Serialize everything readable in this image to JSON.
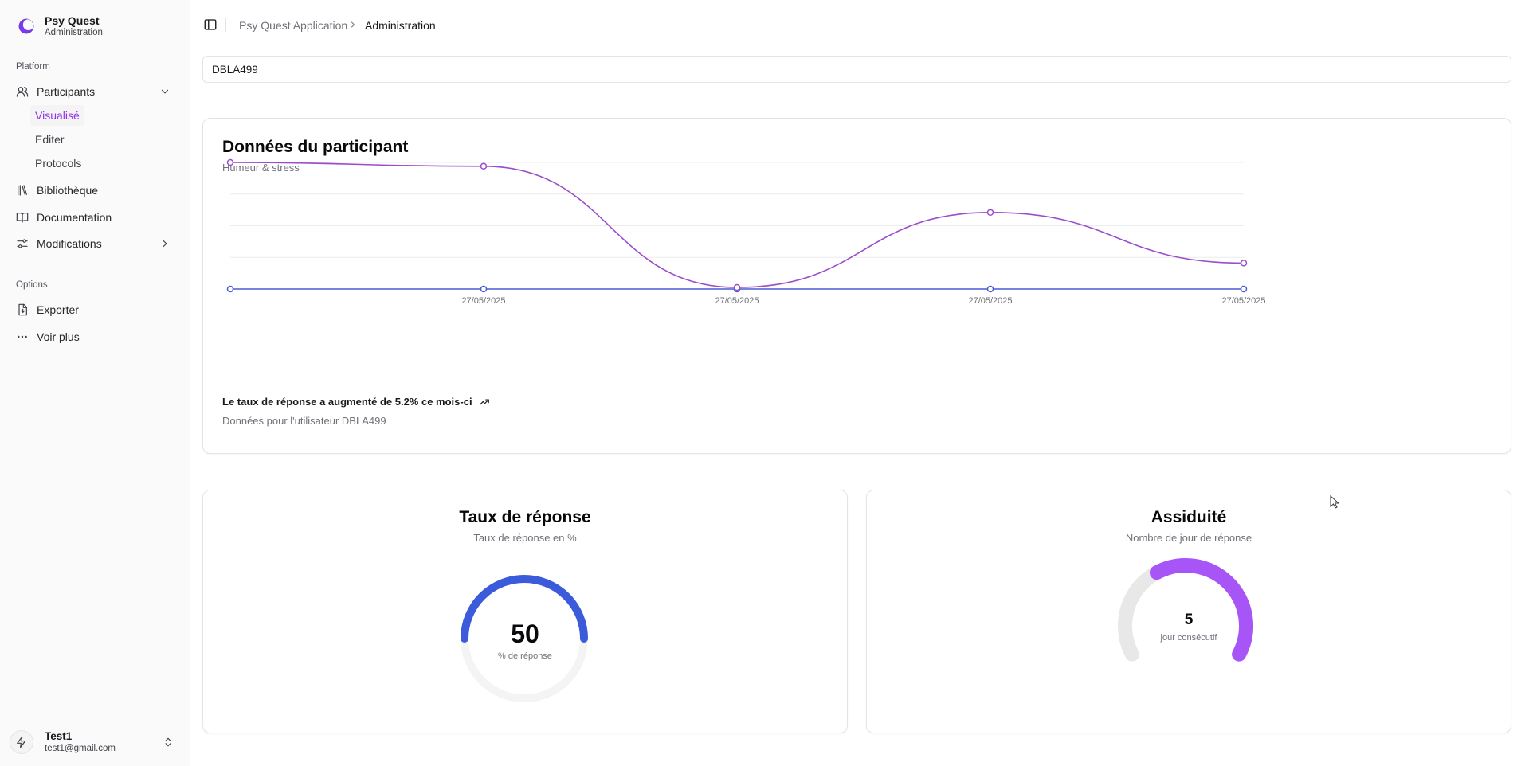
{
  "sidebar": {
    "brand": {
      "title": "Psy Quest",
      "subtitle": "Administration",
      "logo_icon": "crescent-logo",
      "logo_color": "#7c3aed"
    },
    "platform_label": "Platform",
    "participants": {
      "label": "Participants",
      "icon": "users-icon"
    },
    "sub_items": [
      {
        "label": "Visualisé",
        "active": true
      },
      {
        "label": "Editer",
        "active": false
      },
      {
        "label": "Protocols",
        "active": false
      }
    ],
    "bibliotheque": {
      "label": "Bibliothèque",
      "icon": "library-icon"
    },
    "documentation": {
      "label": "Documentation",
      "icon": "book-open-icon"
    },
    "modifications": {
      "label": "Modifications",
      "icon": "sliders-icon"
    },
    "options_label": "Options",
    "exporter": {
      "label": "Exporter",
      "icon": "file-export-icon"
    },
    "voir_plus": {
      "label": "Voir plus",
      "icon": "ellipsis-icon"
    },
    "user": {
      "name": "Test1",
      "email": "test1@gmail.com",
      "avatar_icon": "bolt-icon"
    }
  },
  "header": {
    "breadcrumb": [
      "Psy Quest Application",
      "Administration"
    ]
  },
  "participant_input": {
    "value": "DBLA499"
  },
  "main_card": {
    "title": "Données du participant",
    "subtitle": "Humeur & stress",
    "footer_trend": "Le taux de réponse a augmenté de 5.2% ce mois-ci",
    "footer_note": "Données pour l'utilisateur DBLA499"
  },
  "chart_data": [
    {
      "type": "line",
      "x": [
        "",
        "27/05/2025",
        "27/05/2025",
        "27/05/2025",
        "27/05/2025"
      ],
      "series": [
        {
          "values": [
            4.0,
            3.88,
            0.05,
            2.42,
            0.82
          ],
          "color": "#9b4dca"
        },
        {
          "values": [
            0,
            0,
            0,
            0,
            0
          ],
          "color": "#4a5bd4"
        }
      ],
      "ylim": [
        0,
        4
      ],
      "grid": true
    }
  ],
  "rate_card": {
    "title": "Taux de réponse",
    "subtitle": "Taux de réponse en %",
    "value": "50",
    "unit": "% de réponse",
    "fraction": 0.5,
    "color": "#3b5bdb"
  },
  "attendance_card": {
    "title": "Assiduité",
    "subtitle": "Nombre de jour de réponse",
    "value": "5",
    "unit": "jour consécutif",
    "fraction": 0.62,
    "color": "#a855f7"
  }
}
